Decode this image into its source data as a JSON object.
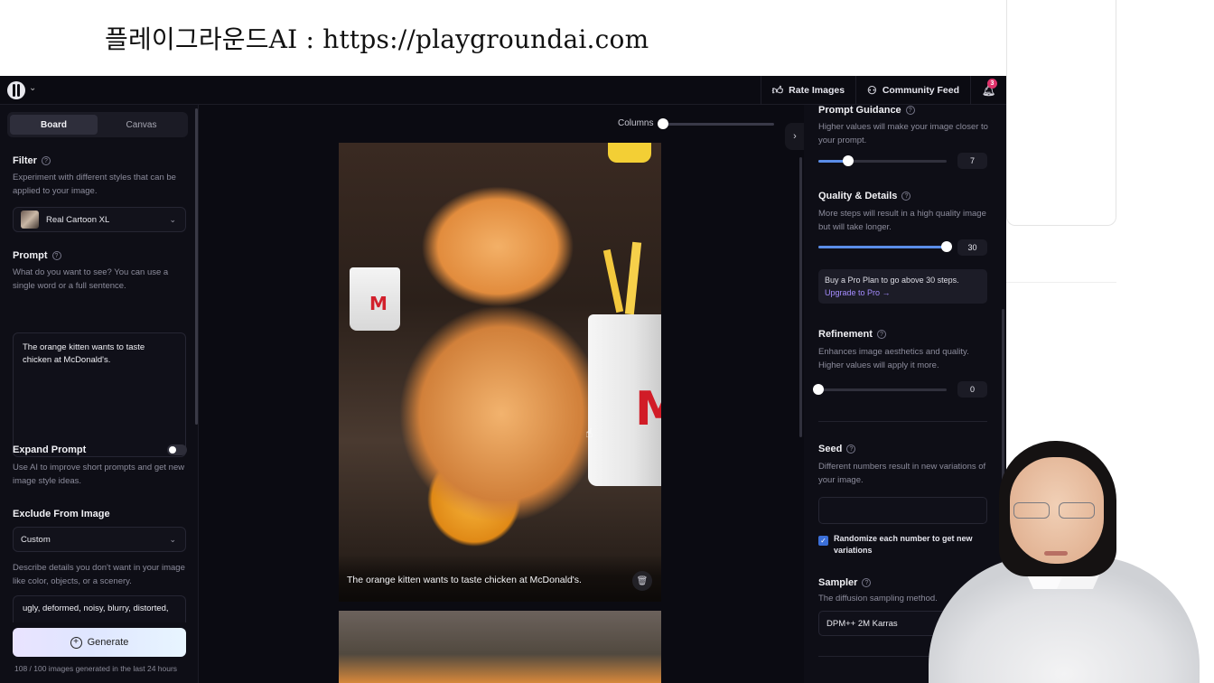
{
  "caption": "플레이그라운드AI : https://playgroundai.com",
  "topbar": {
    "rate_images": "Rate Images",
    "community_feed": "Community Feed",
    "notification_count": "3"
  },
  "left": {
    "tabs": [
      "Board",
      "Canvas"
    ],
    "filter": {
      "title": "Filter",
      "desc": "Experiment with different styles that can be applied to your image.",
      "selected": "Real Cartoon XL"
    },
    "prompt": {
      "title": "Prompt",
      "desc": "What do you want to see? You can use a single word or a full sentence.",
      "value": "The orange kitten wants to taste chicken at McDonald's."
    },
    "expand_prompt": {
      "title": "Expand Prompt",
      "desc": "Use AI to improve short prompts and get new image style ideas."
    },
    "exclude": {
      "title": "Exclude From Image",
      "selected": "Custom",
      "desc": "Describe details you don't want in your image like color, objects, or a scenery.",
      "value": "ugly, deformed, noisy, blurry, distorted,"
    },
    "generate_label": "Generate",
    "quota": "108 / 100 images generated in the last 24 hours"
  },
  "center": {
    "columns_label": "Columns",
    "columns_level": 0.0,
    "image_caption": "The orange kitten wants to taste chicken at McDonald's."
  },
  "right": {
    "prompt_guidance": {
      "title": "Prompt Guidance",
      "desc": "Higher values will make your image closer to your prompt.",
      "value": "7",
      "fraction": 0.23
    },
    "quality": {
      "title": "Quality & Details",
      "desc": "More steps will result in a high quality image but will take longer.",
      "value": "30",
      "fraction": 1.0
    },
    "pro": {
      "text": "Buy a Pro Plan to go above 30 steps.",
      "link": "Upgrade to Pro →"
    },
    "refinement": {
      "title": "Refinement",
      "desc": "Enhances image aesthetics and quality. Higher values will apply it more.",
      "value": "0",
      "fraction": 0.0
    },
    "seed": {
      "title": "Seed",
      "desc": "Different numbers result in new variations of your image.",
      "randomize_label": "Randomize each number to get new variations"
    },
    "sampler": {
      "title": "Sampler",
      "desc": "The diffusion sampling method.",
      "selected": "DPM++ 2M Karras"
    }
  },
  "colors": {
    "app_bg": "#0b0b12",
    "accent": "#5a8de8",
    "link": "#a48cff",
    "badge": "#e0336b"
  }
}
